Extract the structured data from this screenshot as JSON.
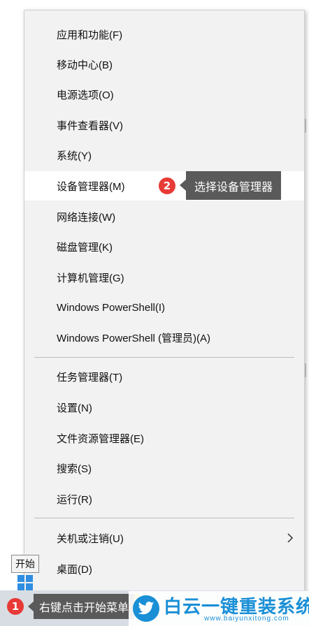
{
  "menu": {
    "items": [
      {
        "label": "应用和功能(F)"
      },
      {
        "label": "移动中心(B)"
      },
      {
        "label": "电源选项(O)"
      },
      {
        "label": "事件查看器(V)"
      },
      {
        "label": "系统(Y)"
      },
      {
        "label": "设备管理器(M)"
      },
      {
        "label": "网络连接(W)"
      },
      {
        "label": "磁盘管理(K)"
      },
      {
        "label": "计算机管理(G)"
      },
      {
        "label": "Windows PowerShell(I)"
      },
      {
        "label": "Windows PowerShell (管理员)(A)"
      },
      {
        "label": "任务管理器(T)"
      },
      {
        "label": "设置(N)"
      },
      {
        "label": "文件资源管理器(E)"
      },
      {
        "label": "搜索(S)"
      },
      {
        "label": "运行(R)"
      },
      {
        "label": "关机或注销(U)"
      },
      {
        "label": "桌面(D)"
      }
    ],
    "highlighted_item": "设备管理器(M)"
  },
  "annotations": {
    "step1_number": "1",
    "step1_text": "右键点击开始菜单",
    "step2_number": "2",
    "step2_text": "选择设备管理器"
  },
  "tooltip": {
    "start_label": "开始"
  },
  "watermark": {
    "title": "白云一键重装系统",
    "url": "www.baiyunxitong.com"
  },
  "colors": {
    "menu_bg": "#f2f2f2",
    "highlight_bg": "#ffffff",
    "badge_red": "#e83a36",
    "callout_bg": "#5a5a5a",
    "brand_blue": "#1a8fd6"
  }
}
